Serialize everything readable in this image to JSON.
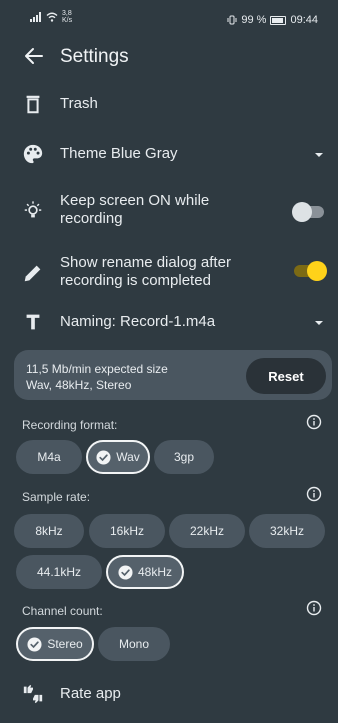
{
  "status_bar": {
    "speed_value": "3,8",
    "speed_unit": "K/s",
    "battery_percent": "99 %",
    "time": "09:44"
  },
  "header": {
    "title": "Settings"
  },
  "settings": {
    "trash_label": "Trash",
    "theme_label": "Theme Blue Gray",
    "keep_screen_label_1": "Keep screen ON while",
    "keep_screen_label_2": "recording",
    "keep_screen_on": false,
    "rename_label_1": "Show rename dialog after",
    "rename_label_2": "recording is completed",
    "rename_on": true,
    "naming_label": "Naming: Record-1.m4a"
  },
  "info_card": {
    "size_text": "11,5 Mb/min expected size",
    "format_text": "Wav, 48kHz, Stereo",
    "reset_label": "Reset"
  },
  "recording_format": {
    "label": "Recording format:",
    "options": [
      "M4a",
      "Wav",
      "3gp"
    ],
    "selected": "Wav"
  },
  "sample_rate": {
    "label": "Sample rate:",
    "options": [
      "8kHz",
      "16kHz",
      "22kHz",
      "32kHz",
      "44.1kHz",
      "48kHz"
    ],
    "selected": "48kHz"
  },
  "channel_count": {
    "label": "Channel count:",
    "options": [
      "Stereo",
      "Mono"
    ],
    "selected": "Stereo"
  },
  "rate_app_label": "Rate app",
  "colors": {
    "background": "#2f3a41",
    "chip": "#4a5660",
    "toggle_on_knob": "#ffd21a"
  }
}
